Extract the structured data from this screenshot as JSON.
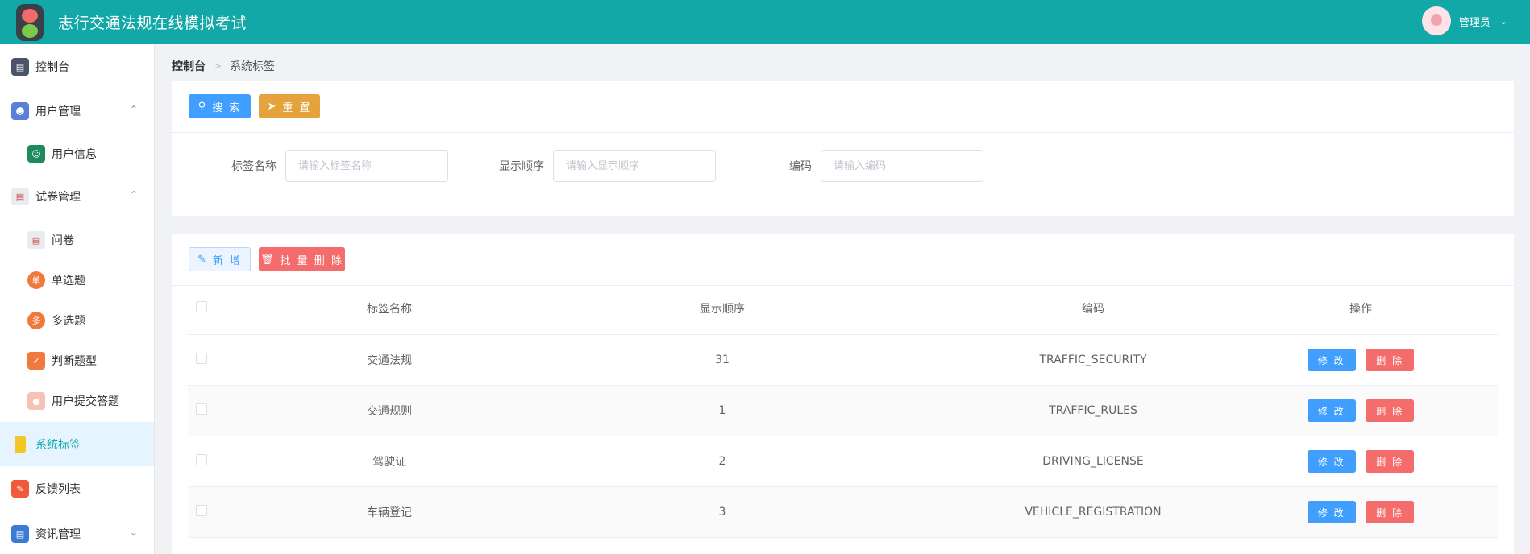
{
  "header": {
    "title": "志行交通法规在线模拟考试",
    "user_name": "管理员"
  },
  "sidebar": {
    "items": [
      {
        "label": "控制台",
        "level": "top",
        "icon": "dashboard-icon",
        "color": "#4a5568"
      },
      {
        "label": "用户管理",
        "level": "top",
        "icon": "user-group-icon",
        "color": "#5b7fd6",
        "expanded": true
      },
      {
        "label": "用户信息",
        "level": "sub",
        "icon": "user-card-icon",
        "color": "#1f8a5b"
      },
      {
        "label": "试卷管理",
        "level": "top",
        "icon": "paper-icon",
        "color": "#9aa0a6",
        "expanded": true
      },
      {
        "label": "问卷",
        "level": "sub",
        "icon": "questionnaire-icon",
        "color": "#9aa0a6"
      },
      {
        "label": "单选题",
        "level": "sub",
        "icon": "single-choice-icon",
        "color": "#f07a3e",
        "badge": "单"
      },
      {
        "label": "多选题",
        "level": "sub",
        "icon": "multi-choice-icon",
        "color": "#f07a3e",
        "badge": "多"
      },
      {
        "label": "判断题型",
        "level": "sub",
        "icon": "judge-icon",
        "color": "#f07a3e"
      },
      {
        "label": "用户提交答题",
        "level": "sub",
        "icon": "submit-icon",
        "color": "#f5b5a8"
      },
      {
        "label": "系统标签",
        "level": "top",
        "icon": "tag-icon",
        "color": "#f3c623",
        "active": true
      },
      {
        "label": "反馈列表",
        "level": "top",
        "icon": "feedback-icon",
        "color": "#f05a3a"
      },
      {
        "label": "资讯管理",
        "level": "top",
        "icon": "news-icon",
        "color": "#3a7bd5",
        "expanded": false
      }
    ]
  },
  "breadcrumb": {
    "home": "控制台",
    "current": "系统标签"
  },
  "search": {
    "search_label": "搜 索",
    "reset_label": "重 置",
    "fields": [
      {
        "label": "标签名称",
        "placeholder": "请输入标签名称"
      },
      {
        "label": "显示顺序",
        "placeholder": "请输入显示顺序"
      },
      {
        "label": "编码",
        "placeholder": "请输入编码"
      }
    ]
  },
  "toolbar": {
    "add_label": "新 增",
    "batch_delete_label": "批 量 删 除"
  },
  "table": {
    "columns": [
      "标签名称",
      "显示顺序",
      "编码",
      "操作"
    ],
    "edit_label": "修 改",
    "delete_label": "删 除",
    "rows": [
      {
        "name": "交通法规",
        "order": "31",
        "code": "TRAFFIC_SECURITY"
      },
      {
        "name": "交通规则",
        "order": "1",
        "code": "TRAFFIC_RULES"
      },
      {
        "name": "驾驶证",
        "order": "2",
        "code": "DRIVING_LICENSE"
      },
      {
        "name": "车辆登记",
        "order": "3",
        "code": "VEHICLE_REGISTRATION"
      }
    ]
  },
  "colors": {
    "header_bg": "#13a8a8",
    "primary": "#409eff",
    "warning": "#e6a23c",
    "danger": "#f56c6c"
  }
}
